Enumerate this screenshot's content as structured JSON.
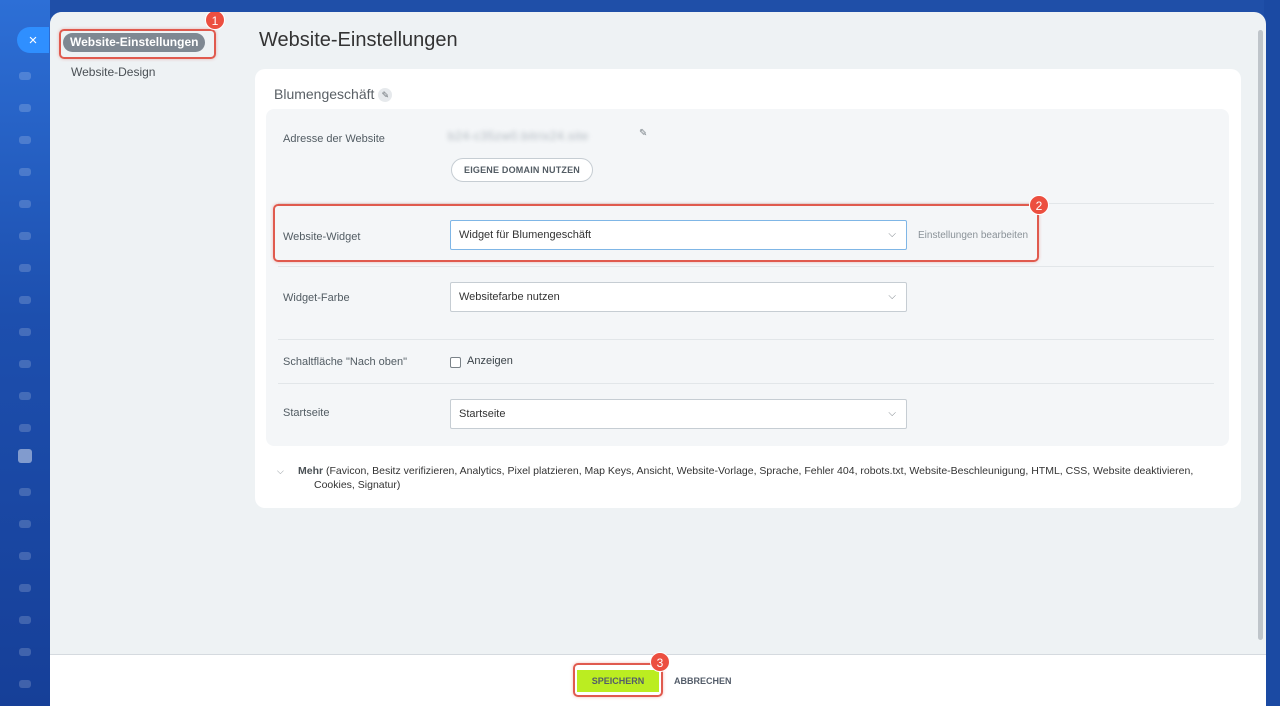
{
  "window": {
    "close_label": "×"
  },
  "sidebar": {
    "items": [
      {
        "label": "Website-Einstellungen"
      },
      {
        "label": "Website-Design"
      }
    ]
  },
  "page": {
    "title": "Website-Einstellungen"
  },
  "site": {
    "name": "Blumengeschäft"
  },
  "address": {
    "label": "Adresse der Website",
    "value": "b24-c35zw0.bitrix24.site",
    "domain_button": "EIGENE DOMAIN NUTZEN"
  },
  "widget": {
    "label": "Website-Widget",
    "selected": "Widget für Blumengeschäft",
    "edit_link": "Einstellungen bearbeiten"
  },
  "widget_color": {
    "label": "Widget-Farbe",
    "selected": "Websitefarbe nutzen"
  },
  "scroll_top": {
    "label": "Schaltfläche \"Nach oben\"",
    "checkbox_label": "Anzeigen",
    "checked": false
  },
  "start_page": {
    "label": "Startseite",
    "selected": "Startseite"
  },
  "more": {
    "title": "Mehr",
    "text": "(Favicon, Besitz verifizieren, Analytics, Pixel platzieren, Map Keys, Ansicht, Website-Vorlage, Sprache, Fehler 404, robots.txt, Website-Beschleunigung, HTML, CSS, Website deaktivieren, Cookies, Signatur)"
  },
  "footer": {
    "save_label": "SPEICHERN",
    "cancel_label": "ABBRECHEN"
  },
  "annotations": [
    {
      "number": "1"
    },
    {
      "number": "2"
    },
    {
      "number": "3"
    }
  ],
  "colors": {
    "accent_save": "#bbed21",
    "highlight": "#e05a4e",
    "close_button": "#2f8fff"
  }
}
